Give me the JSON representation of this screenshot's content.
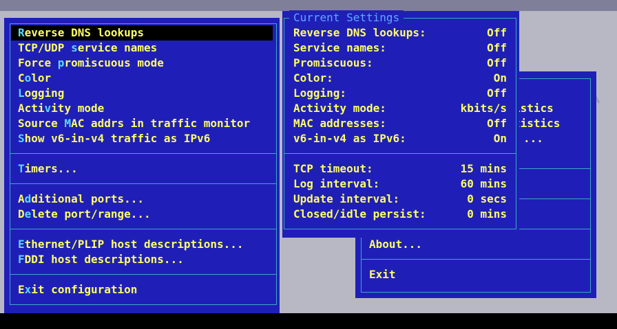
{
  "config_menu": {
    "items": [
      {
        "pre": "",
        "hk": "R",
        "post": "everse DNS lookups"
      },
      {
        "pre": "TCP/UDP ",
        "hk": "s",
        "post": "ervice names"
      },
      {
        "pre": "Force ",
        "hk": "p",
        "post": "romiscuous mode"
      },
      {
        "pre": "C",
        "hk": "o",
        "post": "lor"
      },
      {
        "pre": "",
        "hk": "L",
        "post": "ogging"
      },
      {
        "pre": "Acti",
        "hk": "v",
        "post": "ity mode"
      },
      {
        "pre": "Source ",
        "hk": "M",
        "post": "AC addrs in traffic monitor"
      },
      {
        "pre": "",
        "hk": "S",
        "post": "how v6-in-v4 traffic as IPv6"
      },
      {
        "pre": "",
        "hk": "T",
        "post": "imers..."
      },
      {
        "pre": "A",
        "hk": "d",
        "post": "ditional ports..."
      },
      {
        "pre": "D",
        "hk": "e",
        "post": "lete port/range..."
      },
      {
        "pre": "",
        "hk": "E",
        "post": "thernet/PLIP host descriptions..."
      },
      {
        "pre": "",
        "hk": "F",
        "post": "DDI host descriptions..."
      },
      {
        "pre": "E",
        "hk": "x",
        "post": "it configuration"
      }
    ]
  },
  "current_settings": {
    "title": "Current Settings",
    "rows": [
      {
        "label": "Reverse DNS lookups:",
        "value": "Off"
      },
      {
        "label": "Service names:",
        "value": "Off"
      },
      {
        "label": "Promiscuous:",
        "value": "Off"
      },
      {
        "label": "Color:",
        "value": "On"
      },
      {
        "label": "Logging:",
        "value": "Off"
      },
      {
        "label": "Activity mode:",
        "value": "kbits/s"
      },
      {
        "label": "MAC addresses:",
        "value": "Off"
      },
      {
        "label": "v6-in-v4 as IPv6:",
        "value": "On"
      },
      {
        "label": "TCP timeout:",
        "value": "15 mins"
      },
      {
        "label": "Log interval:",
        "value": "60 mins"
      },
      {
        "label": "Update interval:",
        "value": "0 secs"
      },
      {
        "label": "Closed/idle persist:",
        "value": "0 mins"
      }
    ]
  },
  "main_menu": {
    "partial_1": "istics",
    "partial_2": "tistics",
    "partial_3": "...",
    "about": "About...",
    "exit": "Exit"
  }
}
